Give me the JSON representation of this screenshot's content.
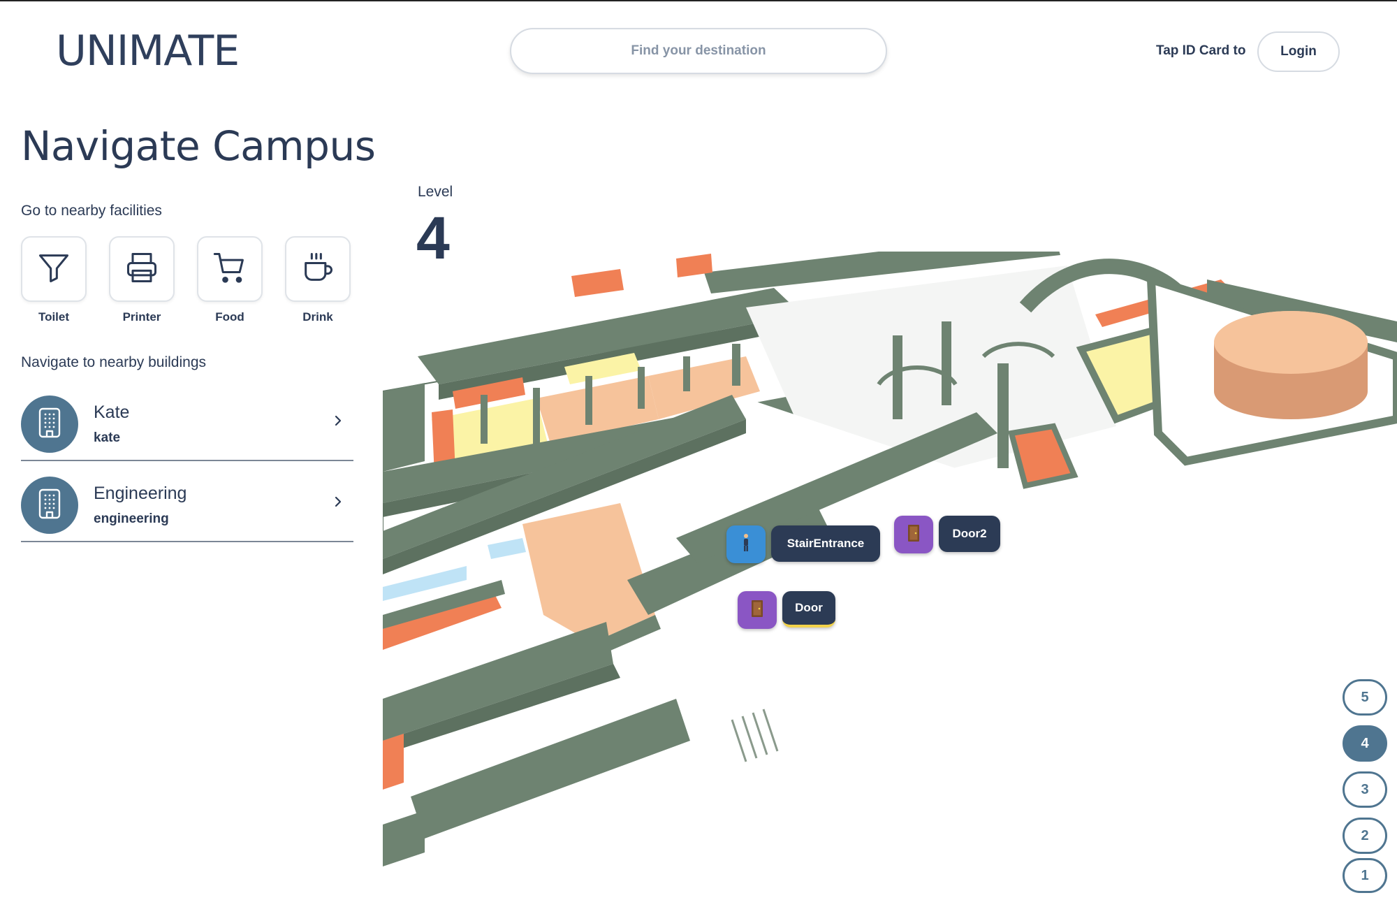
{
  "app": {
    "logo": "UNIMATE"
  },
  "header": {
    "search_placeholder": "Find your destination",
    "tap_label": "Tap ID Card to",
    "login_label": "Login"
  },
  "sidebar": {
    "title": "Navigate Campus",
    "facilities_heading": "Go to nearby facilities",
    "facilities": [
      {
        "label": "Toilet",
        "icon": "filter-icon"
      },
      {
        "label": "Printer",
        "icon": "printer-icon"
      },
      {
        "label": "Food",
        "icon": "cart-icon"
      },
      {
        "label": "Drink",
        "icon": "coffee-cup-icon"
      }
    ],
    "buildings_heading": "Navigate to nearby buildings",
    "buildings": [
      {
        "name": "Kate",
        "subtitle": "kate",
        "icon": "building-icon"
      },
      {
        "name": "Engineering",
        "subtitle": "engineering",
        "icon": "building-icon"
      }
    ]
  },
  "level": {
    "label": "Level",
    "value": "4"
  },
  "map": {
    "markers": [
      {
        "label": "StairEntrance",
        "icon": "person-walking-icon",
        "color": "#3a8fd6"
      },
      {
        "label": "Door2",
        "icon": "door-icon",
        "color": "#8a56c4"
      },
      {
        "label": "Door",
        "icon": "door-icon",
        "color": "#8a56c4"
      }
    ]
  },
  "floors": {
    "buttons": [
      "5",
      "4",
      "3",
      "2",
      "1"
    ],
    "active": "4"
  },
  "colors": {
    "primary": "#2b3a55",
    "accent": "#4f7590",
    "wall": "#6e8371",
    "room_orange": "#f08055",
    "room_peach": "#f6c39b",
    "room_yellow": "#fbf3a6",
    "room_blue": "#bfe3f6"
  }
}
